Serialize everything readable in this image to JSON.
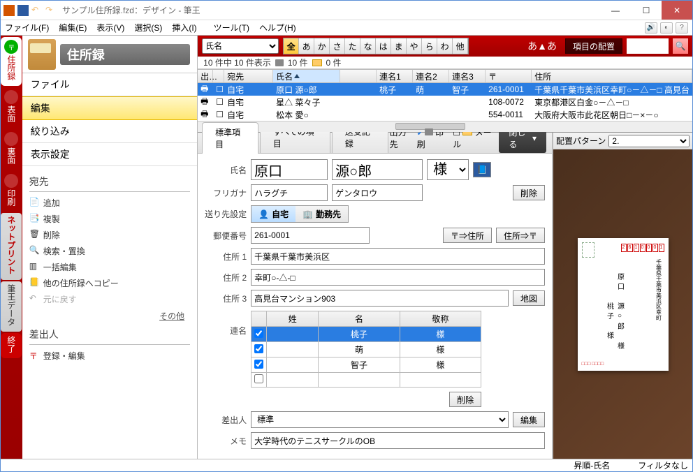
{
  "titlebar": {
    "title": "サンプル住所録.fzd：デザイン - 筆王"
  },
  "menu": {
    "file": "ファイル(F)",
    "edit": "編集(E)",
    "view": "表示(V)",
    "select": "選択(S)",
    "insert": "挿入(I)",
    "tool": "ツール(T)",
    "help": "ヘルプ(H)"
  },
  "vtabs": {
    "addr": "住所録",
    "omote": "表面",
    "ura": "裏面",
    "print": "印刷",
    "net": "ネットプリント",
    "data": "筆王データ",
    "exit": "終了"
  },
  "lp": {
    "title": "住所録",
    "nav": {
      "file": "ファイル",
      "edit": "編集",
      "filter": "絞り込み",
      "disp": "表示設定"
    },
    "dest": {
      "head": "宛先",
      "add": "追加",
      "dup": "複製",
      "del": "削除",
      "find": "検索・置換",
      "bulk": "一括編集",
      "copy": "他の住所録へコピー",
      "undo": "元に戻す",
      "other": "その他"
    },
    "sender": {
      "head": "差出人",
      "reg": "登録・編集"
    }
  },
  "redbar": {
    "sort": "氏名",
    "kana": [
      "全",
      "あ",
      "か",
      "さ",
      "た",
      "な",
      "は",
      "ま",
      "や",
      "ら",
      "わ",
      "他"
    ],
    "aA": "あ▲あ",
    "layout": "項目の配置"
  },
  "count": {
    "text": "10 件中 10 件表示",
    "p": "10 件",
    "m": "0 件"
  },
  "grid": {
    "hdr": {
      "c0": "出…",
      "c2": "宛先",
      "c3": "氏名",
      "c4": "連名1",
      "c5": "連名2",
      "c6": "連名3",
      "c7": "〒",
      "c8": "住所"
    },
    "rows": [
      {
        "sel": true,
        "c2": "自宅",
        "c3": "原口 源○郎",
        "c4": "桃子",
        "c5": "萌",
        "c6": "智子",
        "c7": "261-0001",
        "c8": "千葉県千葉市美浜区幸町○－△－□ 高見台"
      },
      {
        "c2": "自宅",
        "c3": "星△ 菜々子",
        "c4": "",
        "c5": "",
        "c6": "",
        "c7": "108-0072",
        "c8": "東京都港区白金○－△－□"
      },
      {
        "c2": "自宅",
        "c3": "松本 愛○",
        "c4": "",
        "c5": "",
        "c6": "",
        "c7": "554-0011",
        "c8": "大阪府大阪市此花区朝日□－×－○"
      }
    ]
  },
  "tabs": {
    "std": "標準項目",
    "all": "すべての項目",
    "log": "送受記録",
    "out": "出力先",
    "print": "印刷",
    "mail": "メール",
    "close": "閉じる"
  },
  "form": {
    "name_l": "氏名",
    "sei": "原口",
    "mei": "源○郎",
    "keisho": "様",
    "furi_l": "フリガナ",
    "furi1": "ハラグチ",
    "furi2": "ゲンタロウ",
    "del": "削除",
    "dest_l": "送り先設定",
    "home": "自宅",
    "work": "勤務先",
    "zip_l": "郵便番号",
    "zip": "261-0001",
    "z2a": "〒⇒住所",
    "a2z": "住所⇒〒",
    "a1_l": "住所 1",
    "a1": "千葉県千葉市美浜区",
    "a2_l": "住所 2",
    "a2": "幸町○-△-□",
    "a3_l": "住所 3",
    "a3": "高見台マンション903",
    "map": "地図",
    "ren_l": "連名",
    "th1": "姓",
    "th2": "名",
    "th3": "敬称",
    "rrows": [
      {
        "hl": true,
        "n": "桃子",
        "k": "様"
      },
      {
        "n": "萌",
        "k": "様"
      },
      {
        "n": "智子",
        "k": "様"
      }
    ],
    "sender_l": "差出人",
    "sender_v": "標準",
    "editbtn": "編集",
    "memo_l": "メモ",
    "memo": "大学時代のテニスサークルのOB"
  },
  "preview": {
    "pat_l": "配置パターン",
    "pat_v": "2."
  },
  "status": {
    "sort": "昇順-氏名",
    "filter": "フィルタなし"
  }
}
